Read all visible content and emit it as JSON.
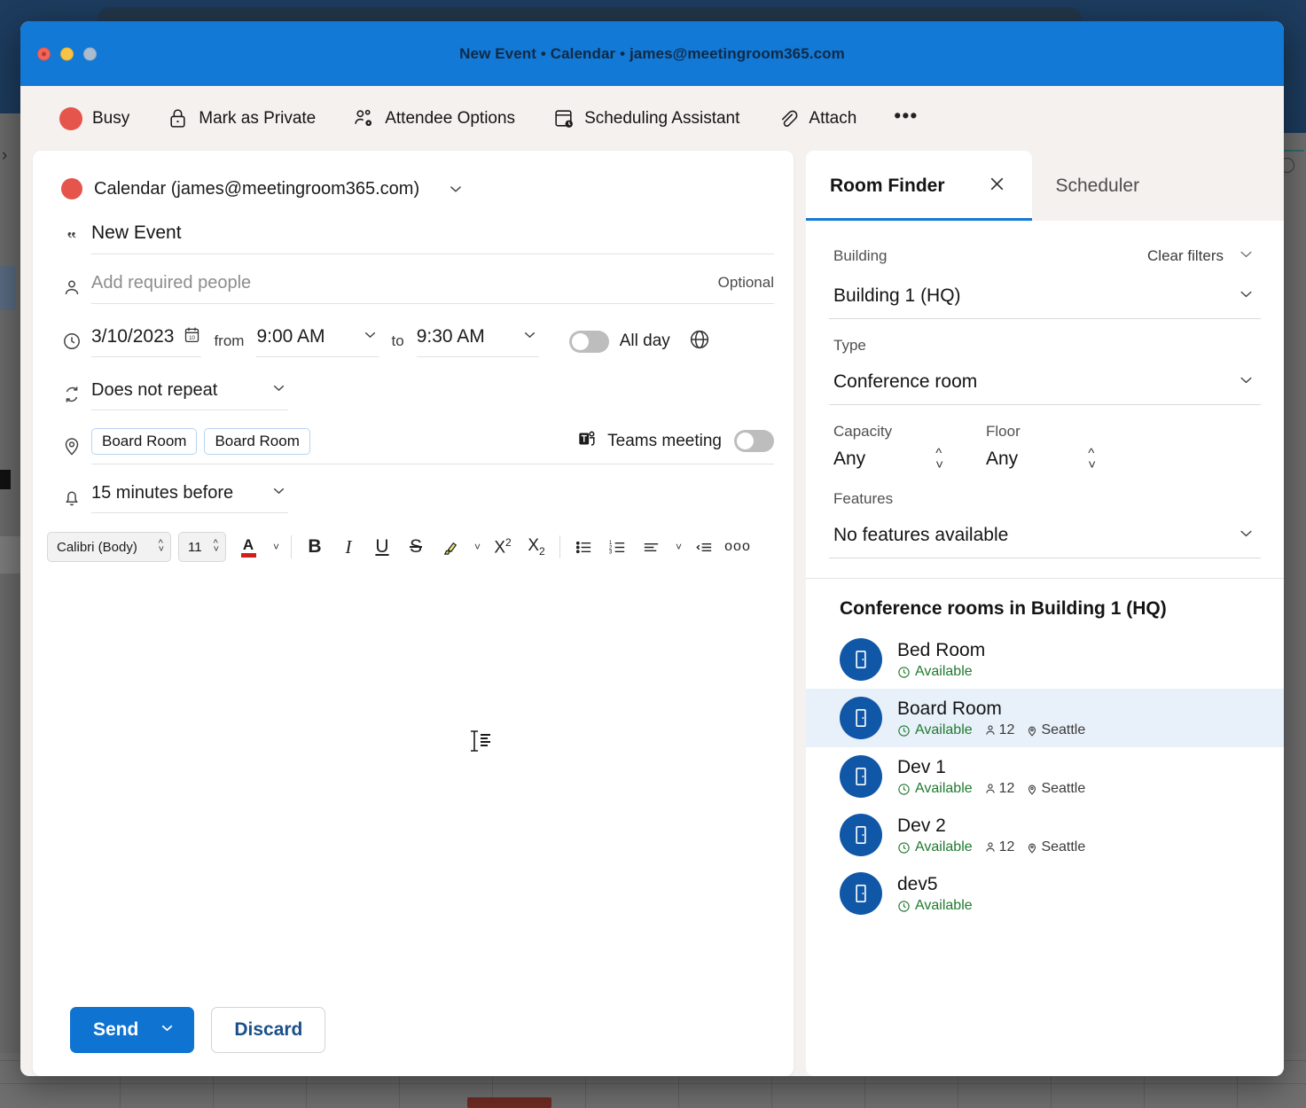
{
  "window": {
    "title": "New Event • Calendar • james@meetingroom365.com",
    "traffic_lights": [
      "close",
      "minimize",
      "zoom"
    ]
  },
  "ribbon": {
    "items": [
      {
        "label": "Busy",
        "icon": "busy-status-dot"
      },
      {
        "label": "Mark as Private",
        "icon": "lock-icon"
      },
      {
        "label": "Attendee Options",
        "icon": "people-settings-icon"
      },
      {
        "label": "Scheduling Assistant",
        "icon": "scheduling-assistant-icon"
      },
      {
        "label": "Attach",
        "icon": "paperclip-icon"
      },
      {
        "label": "More options",
        "icon": "ellipsis-icon"
      }
    ],
    "overflow_label": "•••"
  },
  "compose": {
    "calendar": {
      "value": "Calendar (james@meetingroom365.com)",
      "icon": "calendar-color-dot"
    },
    "title": {
      "value": "New Event",
      "icon": "quote-icon"
    },
    "people": {
      "placeholder": "Add required people",
      "optional_label": "Optional",
      "icon": "person-icon"
    },
    "datetime": {
      "date": "3/10/2023",
      "from_label": "from",
      "start_time": "9:00 AM",
      "to_label": "to",
      "end_time": "9:30 AM",
      "all_day_label": "All day",
      "all_day_on": false,
      "icon": "clock-icon",
      "calendar_picker_icon": "calendar-picker-icon",
      "timezone_icon": "globe-icon"
    },
    "repeat": {
      "value": "Does not repeat",
      "icon": "repeat-icon"
    },
    "location": {
      "chips": [
        "Board Room",
        "Board Room"
      ],
      "teams_label": "Teams meeting",
      "teams_on": false,
      "icon": "location-pin-icon",
      "teams_icon": "teams-icon"
    },
    "reminder": {
      "value": "15 minutes before",
      "icon": "bell-icon"
    },
    "format_toolbar": {
      "font_name": "Calibri (Body)",
      "font_size": "11",
      "font_color_hex": "#d21d1d",
      "buttons": [
        {
          "name": "font-color-button",
          "label": "A"
        },
        {
          "name": "bold-button",
          "label": "B"
        },
        {
          "name": "italic-button",
          "label": "I"
        },
        {
          "name": "underline-button",
          "label": "U"
        },
        {
          "name": "strikethrough-button",
          "label": "S"
        },
        {
          "name": "highlight-button",
          "label": "highlighter"
        },
        {
          "name": "superscript-button",
          "label": "X²"
        },
        {
          "name": "subscript-button",
          "label": "X₂"
        },
        {
          "name": "bulleted-list-button",
          "label": "bullets"
        },
        {
          "name": "numbered-list-button",
          "label": "numbers"
        },
        {
          "name": "align-button",
          "label": "align"
        },
        {
          "name": "indent-button",
          "label": "indent"
        },
        {
          "name": "more-formatting-button",
          "label": "ooo"
        }
      ]
    },
    "body_text": "",
    "actions": {
      "send_label": "Send",
      "discard_label": "Discard"
    }
  },
  "room_finder": {
    "tabs": [
      {
        "label": "Room Finder",
        "active": true
      },
      {
        "label": "Scheduler",
        "active": false
      }
    ],
    "close_icon": "close-icon",
    "filters": {
      "building_label": "Building",
      "clear_filters_label": "Clear filters",
      "building_value": "Building 1 (HQ)",
      "type_label": "Type",
      "type_value": "Conference room",
      "capacity_label": "Capacity",
      "capacity_value": "Any",
      "floor_label": "Floor",
      "floor_value": "Any",
      "features_label": "Features",
      "features_value": "No features available"
    },
    "rooms_heading": "Conference rooms in Building 1 (HQ)",
    "rooms": [
      {
        "name": "Bed Room",
        "status": "Available",
        "capacity": "",
        "location": "",
        "selected": false
      },
      {
        "name": "Board Room",
        "status": "Available",
        "capacity": "12",
        "location": "Seattle",
        "selected": true
      },
      {
        "name": "Dev 1",
        "status": "Available",
        "capacity": "12",
        "location": "Seattle",
        "selected": false
      },
      {
        "name": "Dev 2",
        "status": "Available",
        "capacity": "12",
        "location": "Seattle",
        "selected": false
      },
      {
        "name": "dev5",
        "status": "Available",
        "capacity": "",
        "location": "",
        "selected": false
      }
    ]
  },
  "colors": {
    "titlebar": "#1379d6",
    "accent": "#0f73d1",
    "busy": "#e5554c",
    "available": "#1f7a2e",
    "room_avatar": "#1157a8",
    "selected_row": "#e8f0fa"
  }
}
